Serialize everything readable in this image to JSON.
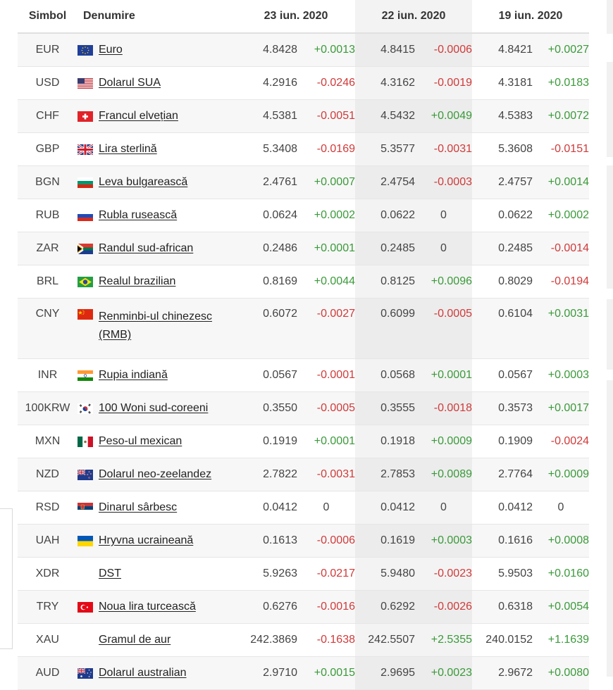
{
  "headers": {
    "symbol": "Simbol",
    "name": "Denumire",
    "date1": "23 iun. 2020",
    "date2": "22 iun. 2020",
    "date3": "19 iun. 2020"
  },
  "colors": {
    "positive": "#3a9a3a",
    "negative": "#d03a3a"
  },
  "rows": [
    {
      "sym": "EUR",
      "flag": "eu-flag-icon",
      "name": "Euro",
      "v1": "4.8428",
      "c1": "+0.0013",
      "v2": "4.8415",
      "c2": "-0.0006",
      "v3": "4.8421",
      "c3": "+0.0027"
    },
    {
      "sym": "USD",
      "flag": "us-flag-icon",
      "name": "Dolarul SUA",
      "v1": "4.2916",
      "c1": "-0.0246",
      "v2": "4.3162",
      "c2": "-0.0019",
      "v3": "4.3181",
      "c3": "+0.0183"
    },
    {
      "sym": "CHF",
      "flag": "ch-flag-icon",
      "name": "Francul elvețian",
      "v1": "4.5381",
      "c1": "-0.0051",
      "v2": "4.5432",
      "c2": "+0.0049",
      "v3": "4.5383",
      "c3": "+0.0072"
    },
    {
      "sym": "GBP",
      "flag": "gb-flag-icon",
      "name": "Lira sterlină",
      "v1": "5.3408",
      "c1": "-0.0169",
      "v2": "5.3577",
      "c2": "-0.0031",
      "v3": "5.3608",
      "c3": "-0.0151"
    },
    {
      "sym": "BGN",
      "flag": "bg-flag-icon",
      "name": "Leva bulgarească",
      "v1": "2.4761",
      "c1": "+0.0007",
      "v2": "2.4754",
      "c2": "-0.0003",
      "v3": "2.4757",
      "c3": "+0.0014"
    },
    {
      "sym": "RUB",
      "flag": "ru-flag-icon",
      "name": "Rubla rusească",
      "v1": "0.0624",
      "c1": "+0.0002",
      "v2": "0.0622",
      "c2": "0",
      "v3": "0.0622",
      "c3": "+0.0002"
    },
    {
      "sym": "ZAR",
      "flag": "za-flag-icon",
      "name": "Randul sud-african",
      "v1": "0.2486",
      "c1": "+0.0001",
      "v2": "0.2485",
      "c2": "0",
      "v3": "0.2485",
      "c3": "-0.0014"
    },
    {
      "sym": "BRL",
      "flag": "br-flag-icon",
      "name": "Realul brazilian",
      "v1": "0.8169",
      "c1": "+0.0044",
      "v2": "0.8125",
      "c2": "+0.0096",
      "v3": "0.8029",
      "c3": "-0.0194"
    },
    {
      "sym": "CNY",
      "flag": "cn-flag-icon",
      "name": "Renminbi-ul chinezesc (RMB)",
      "v1": "0.6072",
      "c1": "-0.0027",
      "v2": "0.6099",
      "c2": "-0.0005",
      "v3": "0.6104",
      "c3": "+0.0031"
    },
    {
      "sym": "INR",
      "flag": "in-flag-icon",
      "name": "Rupia indiană",
      "v1": "0.0567",
      "c1": "-0.0001",
      "v2": "0.0568",
      "c2": "+0.0001",
      "v3": "0.0567",
      "c3": "+0.0003"
    },
    {
      "sym": "100KRW",
      "flag": "kr-flag-icon",
      "name": "100 Woni sud-coreeni",
      "v1": "0.3550",
      "c1": "-0.0005",
      "v2": "0.3555",
      "c2": "-0.0018",
      "v3": "0.3573",
      "c3": "+0.0017"
    },
    {
      "sym": "MXN",
      "flag": "mx-flag-icon",
      "name": "Peso-ul mexican",
      "v1": "0.1919",
      "c1": "+0.0001",
      "v2": "0.1918",
      "c2": "+0.0009",
      "v3": "0.1909",
      "c3": "-0.0024"
    },
    {
      "sym": "NZD",
      "flag": "nz-flag-icon",
      "name": "Dolarul neo-zeelandez",
      "v1": "2.7822",
      "c1": "-0.0031",
      "v2": "2.7853",
      "c2": "+0.0089",
      "v3": "2.7764",
      "c3": "+0.0009"
    },
    {
      "sym": "RSD",
      "flag": "rs-flag-icon",
      "name": "Dinarul sârbesc",
      "v1": "0.0412",
      "c1": "0",
      "v2": "0.0412",
      "c2": "0",
      "v3": "0.0412",
      "c3": "0"
    },
    {
      "sym": "UAH",
      "flag": "ua-flag-icon",
      "name": "Hryvna ucraineană",
      "v1": "0.1613",
      "c1": "-0.0006",
      "v2": "0.1619",
      "c2": "+0.0003",
      "v3": "0.1616",
      "c3": "+0.0008"
    },
    {
      "sym": "XDR",
      "flag": "",
      "name": "DST",
      "v1": "5.9263",
      "c1": "-0.0217",
      "v2": "5.9480",
      "c2": "-0.0023",
      "v3": "5.9503",
      "c3": "+0.0160"
    },
    {
      "sym": "TRY",
      "flag": "tr-flag-icon",
      "name": "Noua lira turcească",
      "v1": "0.6276",
      "c1": "-0.0016",
      "v2": "0.6292",
      "c2": "-0.0026",
      "v3": "0.6318",
      "c3": "+0.0054"
    },
    {
      "sym": "XAU",
      "flag": "",
      "name": "Gramul de aur",
      "v1": "242.3869",
      "c1": "-0.1638",
      "v2": "242.5507",
      "c2": "+2.5355",
      "v3": "240.0152",
      "c3": "+1.1639"
    },
    {
      "sym": "AUD",
      "flag": "au-flag-icon",
      "name": "Dolarul australian",
      "v1": "2.9710",
      "c1": "+0.0015",
      "v2": "2.9695",
      "c2": "+0.0023",
      "v3": "2.9672",
      "c3": "+0.0080"
    }
  ]
}
